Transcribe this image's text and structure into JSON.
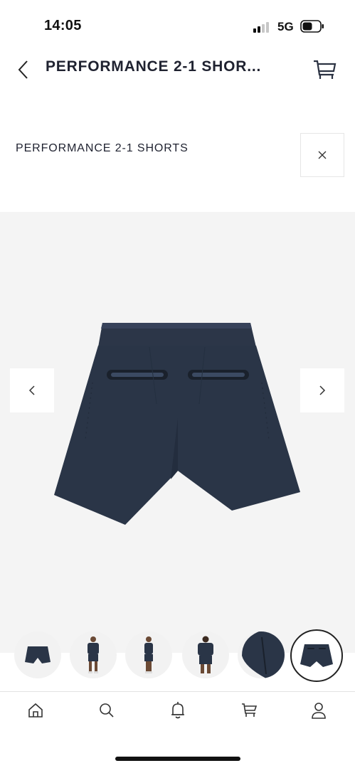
{
  "status": {
    "time": "14:05",
    "network": "5G"
  },
  "header": {
    "title": "PERFORMANCE 2-1 SHOR...",
    "back_icon": "chevron-left-icon",
    "cart_icon": "cart-icon"
  },
  "product": {
    "title": "PERFORMANCE 2-1 SHORTS",
    "close_icon": "close-icon"
  },
  "gallery": {
    "image": "navy-shorts-back-view",
    "prev_icon": "chevron-left-icon",
    "next_icon": "chevron-right-icon",
    "thumbnails": [
      {
        "image": "shorts-front"
      },
      {
        "image": "model-front"
      },
      {
        "image": "model-side"
      },
      {
        "image": "model-back"
      },
      {
        "image": "fabric-detail"
      },
      {
        "image": "shorts-back",
        "selected": true
      }
    ]
  },
  "tabbar": {
    "items": [
      "home-icon",
      "search-icon",
      "bell-icon",
      "cart-icon",
      "profile-icon"
    ]
  },
  "colors": {
    "product": "#2a3548",
    "text": "#1f2230",
    "gallery_bg": "#f4f4f4"
  }
}
